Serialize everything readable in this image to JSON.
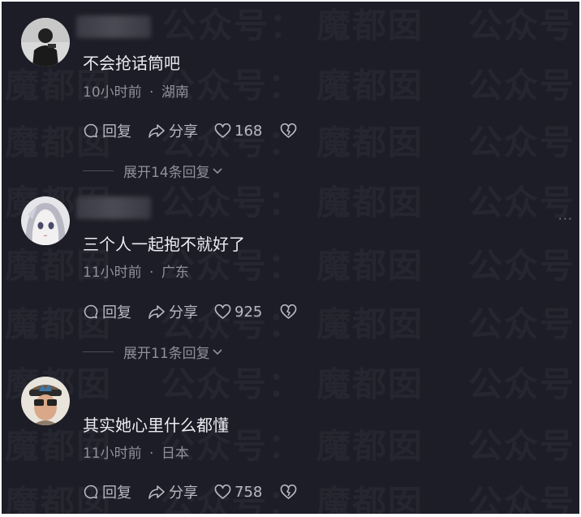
{
  "watermark": {
    "text": "魔都囡",
    "label": "公众号："
  },
  "comments": [
    {
      "text": "不会抢话筒吧",
      "time": "10小时前",
      "separator": "·",
      "location": "湖南",
      "reply_label": "回复",
      "share_label": "分享",
      "likes": "168",
      "expand_label": "展开14条回复"
    },
    {
      "text": "三个人一起抱不就好了",
      "time": "11小时前",
      "separator": "·",
      "location": "广东",
      "reply_label": "回复",
      "share_label": "分享",
      "likes": "925",
      "expand_label": "展开11条回复"
    },
    {
      "text": "其实她心里什么都懂",
      "time": "11小时前",
      "separator": "·",
      "location": "日本",
      "reply_label": "回复",
      "share_label": "分享",
      "likes": "758"
    }
  ],
  "more_menu": "···",
  "colors": {
    "background": "#1c1d26",
    "text_primary": "#ecedf2",
    "text_secondary": "#8f909a"
  }
}
